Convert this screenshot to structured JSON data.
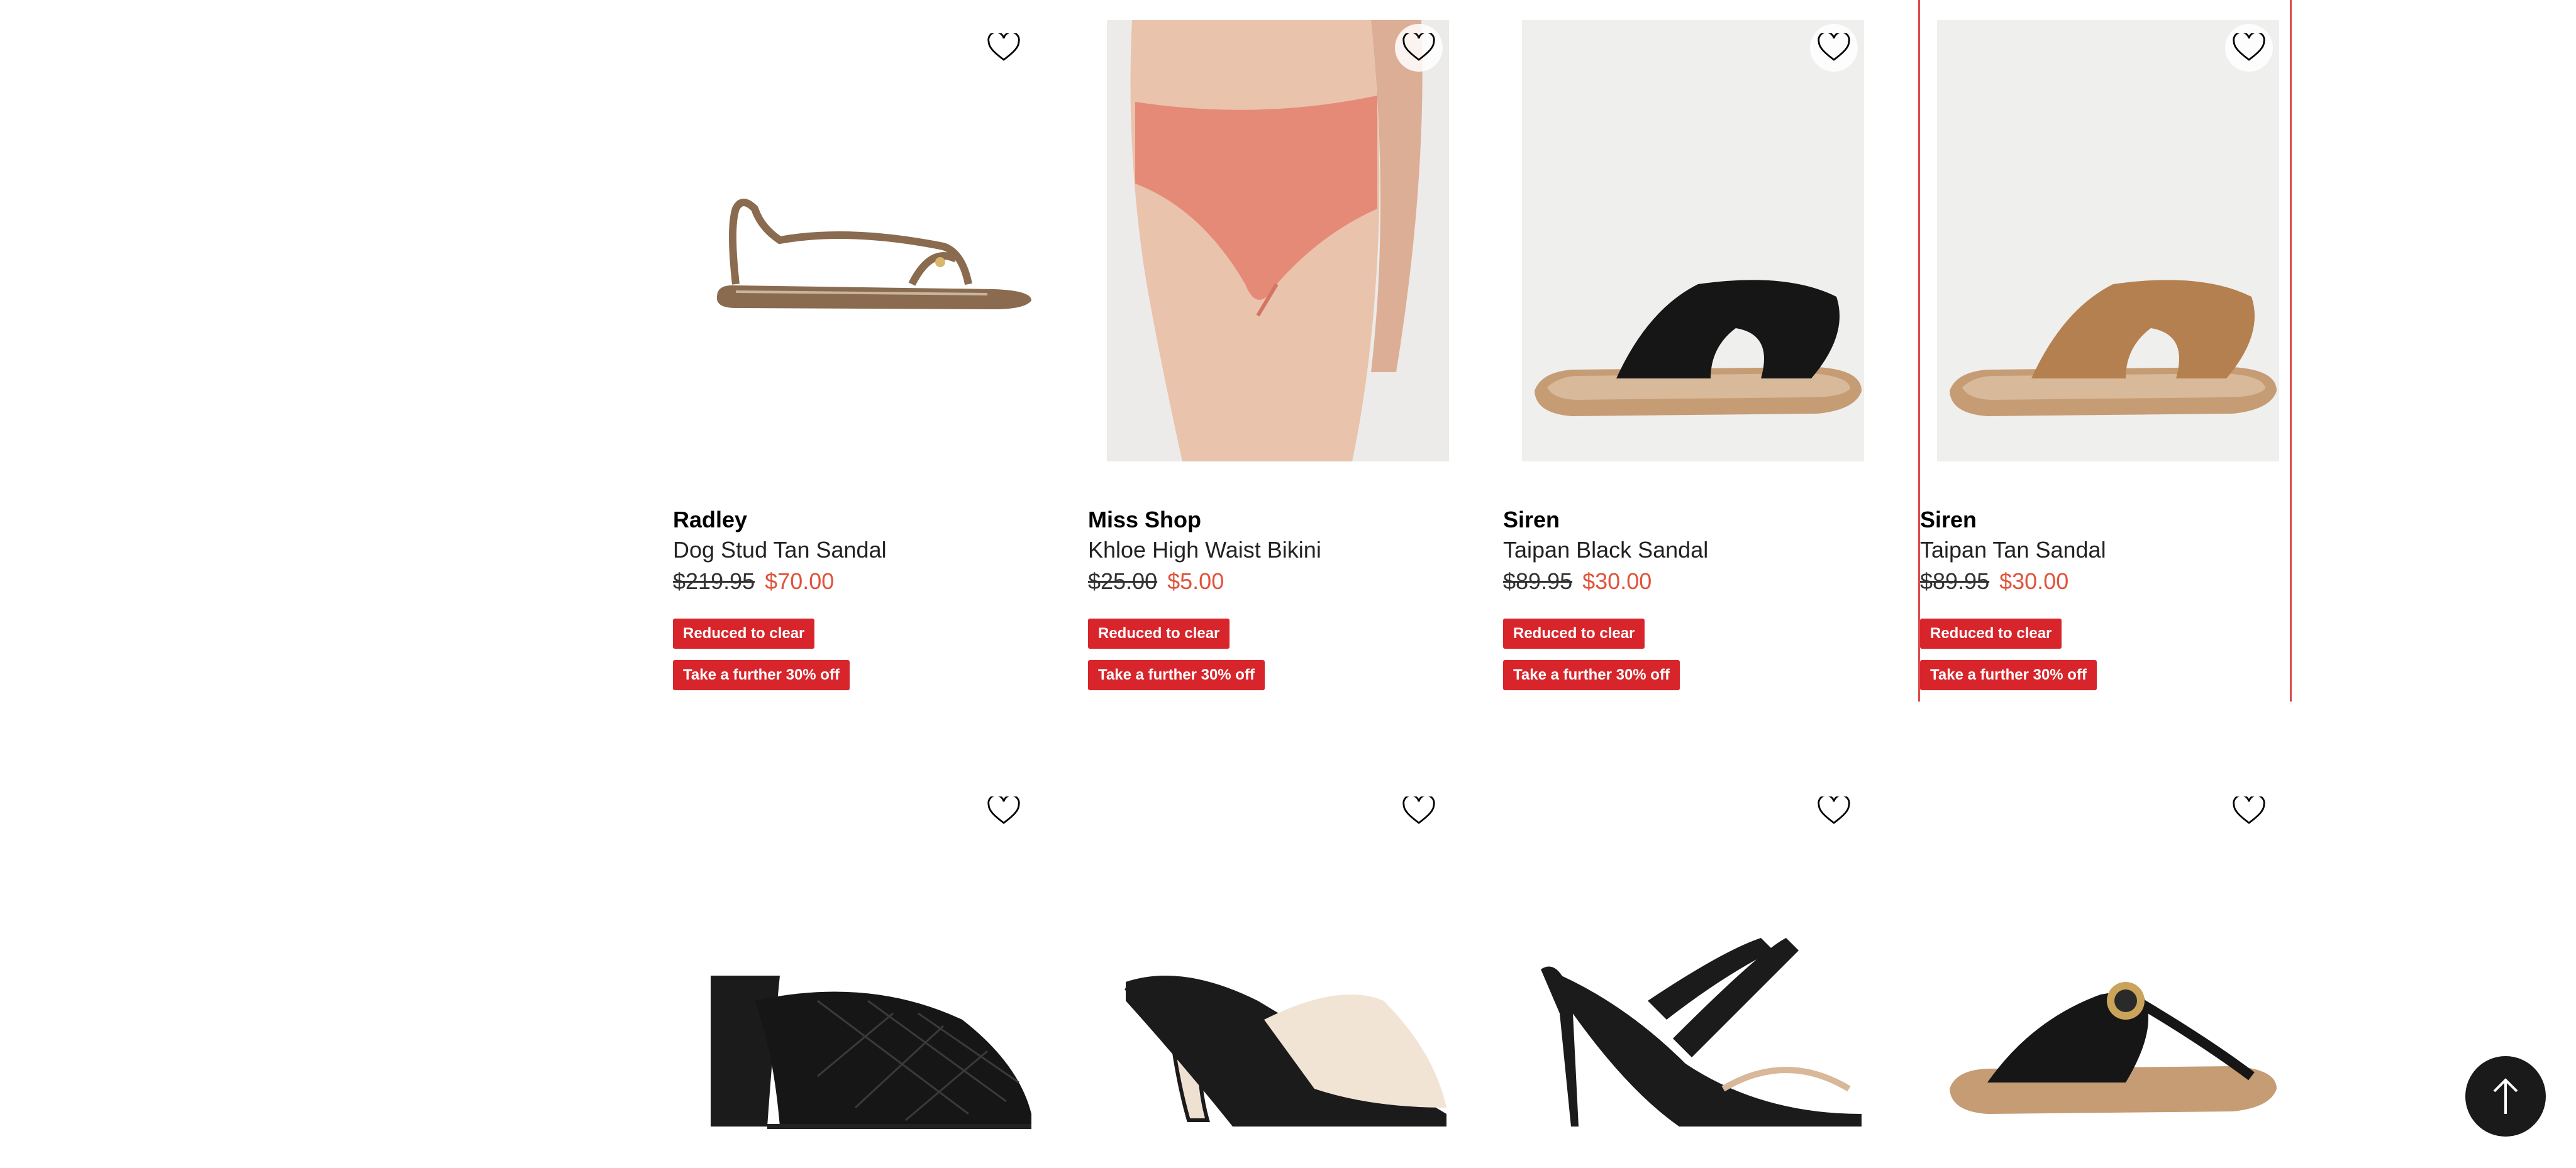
{
  "products": [
    {
      "brand": "Radley",
      "name": "Dog Stud Tan Sandal",
      "was_price": "$219.95",
      "now_price": "$70.00",
      "badge1": "Reduced to clear",
      "badge2": "Take a further 30% off",
      "image": "tan-strappy-sandal"
    },
    {
      "brand": "Miss Shop",
      "name": "Khloe High Waist Bikini",
      "was_price": "$25.00",
      "now_price": "$5.00",
      "badge1": "Reduced to clear",
      "badge2": "Take a further 30% off",
      "image": "coral-bikini-bottom"
    },
    {
      "brand": "Siren",
      "name": "Taipan Black Sandal",
      "was_price": "$89.95",
      "now_price": "$30.00",
      "badge1": "Reduced to clear",
      "badge2": "Take a further 30% off",
      "image": "black-slide-sandal"
    },
    {
      "brand": "Siren",
      "name": "Taipan Tan Sandal",
      "was_price": "$89.95",
      "now_price": "$30.00",
      "badge1": "Reduced to clear",
      "badge2": "Take a further 30% off",
      "image": "tan-slide-sandal"
    }
  ],
  "products_row2": [
    {
      "image": "black-quilted-block-heel-mule"
    },
    {
      "image": "cream-square-toe-heel-mule"
    },
    {
      "image": "black-strappy-stiletto-sandal"
    },
    {
      "image": "black-thong-flat-sandal"
    }
  ],
  "colors": {
    "sale_price": "#e0533b",
    "badge_bg": "#d8252b",
    "selected_outline": "#e04b4b",
    "back_to_top_bg": "#1a1a1a"
  },
  "icons": {
    "wishlist": "heart-icon",
    "back_to_top": "arrow-up-icon"
  }
}
